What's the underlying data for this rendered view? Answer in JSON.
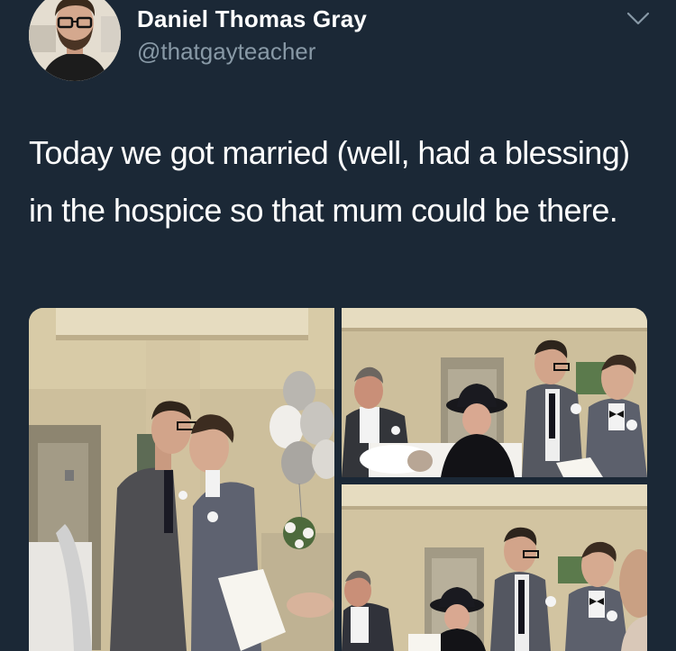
{
  "tweet": {
    "author": {
      "display_name": "Daniel Thomas Gray",
      "handle": "@thatgayteacher"
    },
    "text": "Today we got married (well, had a blessing) in the hospice so that mum could be there.",
    "icons": {
      "options": "chevron-down-icon"
    },
    "media_count": 3
  },
  "colors": {
    "background": "#1b2836",
    "text_primary": "#ffffff",
    "text_secondary": "#8899a6"
  }
}
